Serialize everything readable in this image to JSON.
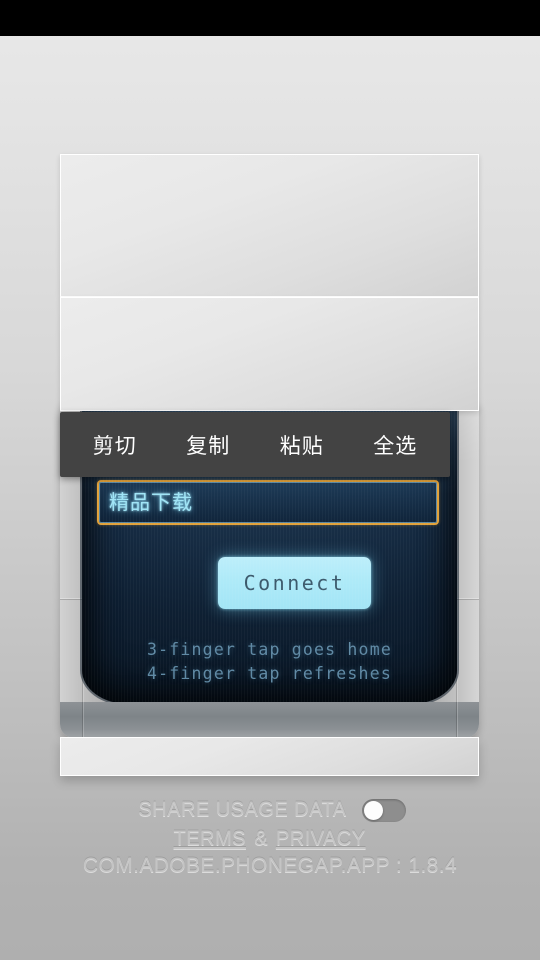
{
  "status_bar": {
    "color": "#000000"
  },
  "context_menu": {
    "items": [
      {
        "label": "剪切",
        "name": "cut"
      },
      {
        "label": "复制",
        "name": "copy"
      },
      {
        "label": "粘贴",
        "name": "paste"
      },
      {
        "label": "全选",
        "name": "select-all"
      }
    ],
    "background": "#434343"
  },
  "screen": {
    "host_input": {
      "value": "精品下载",
      "placeholder": "",
      "border_color": "#e2a23a",
      "text_color": "#9fe4f6"
    },
    "connect_button": {
      "label": "Connect",
      "background": "#aeeaf8",
      "text_color": "#3c5a6c"
    },
    "hints": [
      "3-finger tap goes home",
      "4-finger tap refreshes"
    ],
    "background": "#152a41"
  },
  "footer": {
    "share_usage_label": "SHARE USAGE DATA",
    "toggle": {
      "state": "off",
      "track_color": "#8e8e8e",
      "knob_color": "#fdfdfd"
    },
    "terms_label": "TERMS",
    "separator": "&",
    "privacy_label": "PRIVACY",
    "version_line": "COM.ADOBE.PHONEGAP.APP : 1.8.4",
    "text_color": "#c4c4c4"
  }
}
